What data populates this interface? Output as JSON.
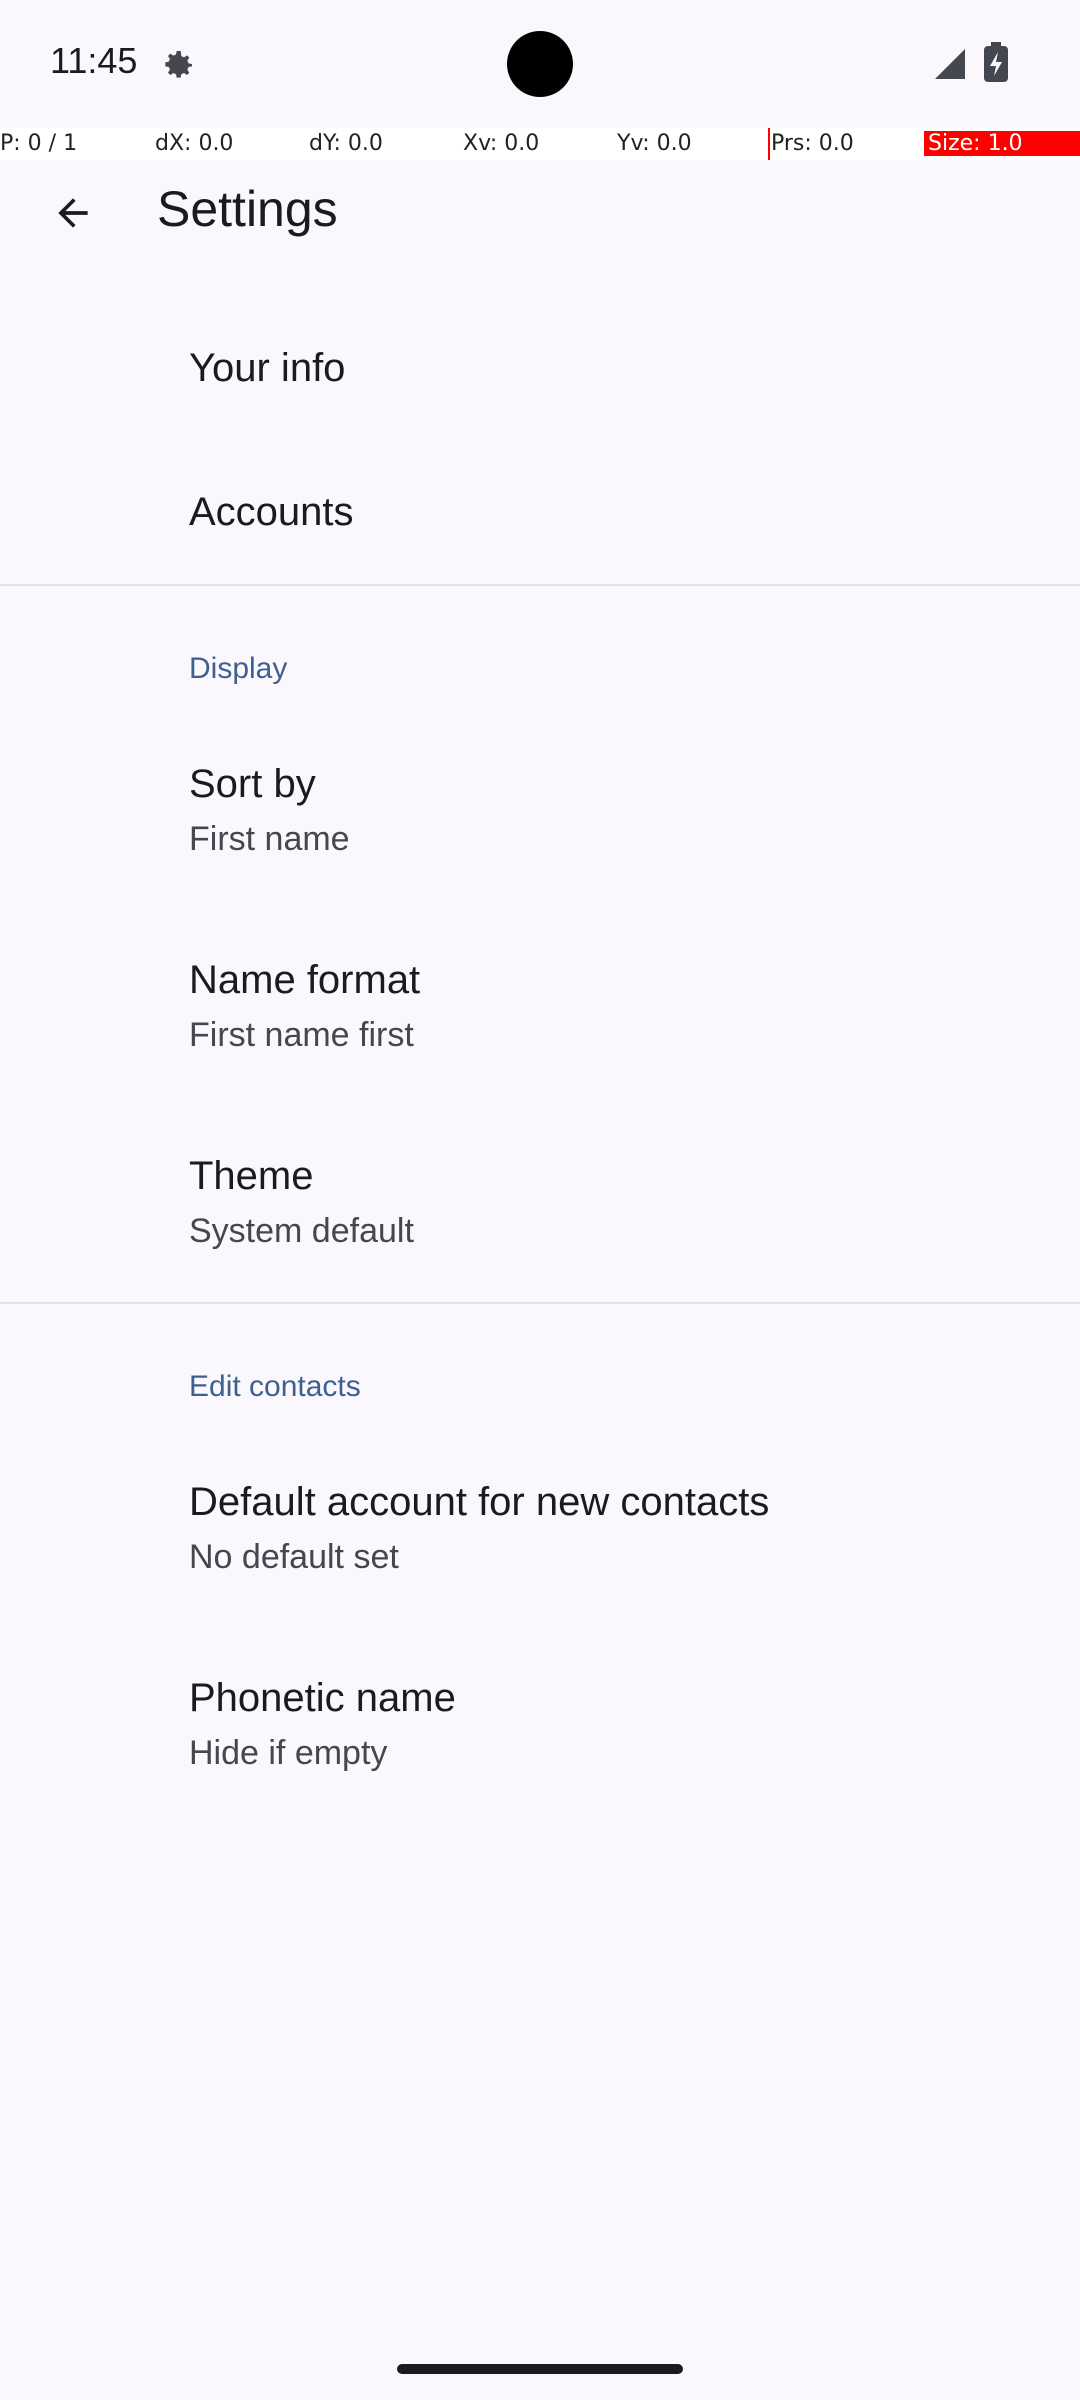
{
  "status": {
    "time": "11:45"
  },
  "debug": {
    "p": "P: 0 / 1",
    "dx": "dX: 0.0",
    "dy": "dY: 0.0",
    "xv": "Xv: 0.0",
    "yv": "Yv: 0.0",
    "prs": "Prs: 0.0",
    "size": "Size: 1.0"
  },
  "appbar": {
    "title": "Settings"
  },
  "top_items": [
    {
      "label": "Your info"
    },
    {
      "label": "Accounts"
    }
  ],
  "display": {
    "header": "Display",
    "items": [
      {
        "label": "Sort by",
        "value": "First name"
      },
      {
        "label": "Name format",
        "value": "First name first"
      },
      {
        "label": "Theme",
        "value": "System default"
      }
    ]
  },
  "edit_contacts": {
    "header": "Edit contacts",
    "items": [
      {
        "label": "Default account for new contacts",
        "value": "No default set"
      },
      {
        "label": "Phonetic name",
        "value": "Hide if empty"
      }
    ]
  },
  "colors": {
    "background": "#FAF8FC",
    "accent": "#3F5F90",
    "debug_highlight": "#FF0000"
  }
}
